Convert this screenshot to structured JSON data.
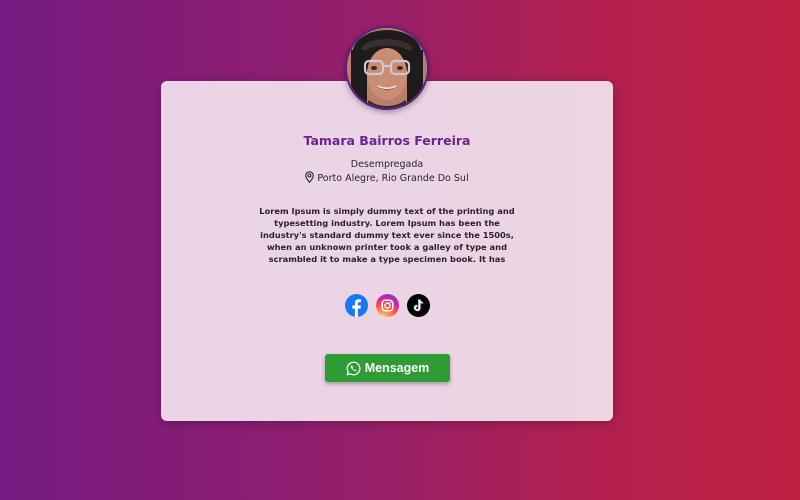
{
  "profile": {
    "name": "Tamara Bairros Ferreira",
    "job": "Desempregada",
    "location": "Porto Alegre, Rio Grande Do Sul",
    "bio": "Lorem Ipsum is simply dummy text of the printing and typesetting industry. Lorem Ipsum has been the industry's standard dummy text ever since the 1500s, when an unknown printer took a galley of type and scrambled it to make a type specimen book. It has"
  },
  "socials": [
    {
      "icon": "facebook-icon",
      "color": "#1877f2"
    },
    {
      "icon": "instagram-icon",
      "color": "#d6249f"
    },
    {
      "icon": "tiktok-icon",
      "color": "#000000"
    }
  ],
  "button": {
    "label": "Mensagem",
    "icon": "whatsapp-icon",
    "color": "#2f9b35"
  },
  "theme": {
    "gradient_start": "#741a82",
    "gradient_end": "#bd2141",
    "name_color": "#6a2391"
  }
}
